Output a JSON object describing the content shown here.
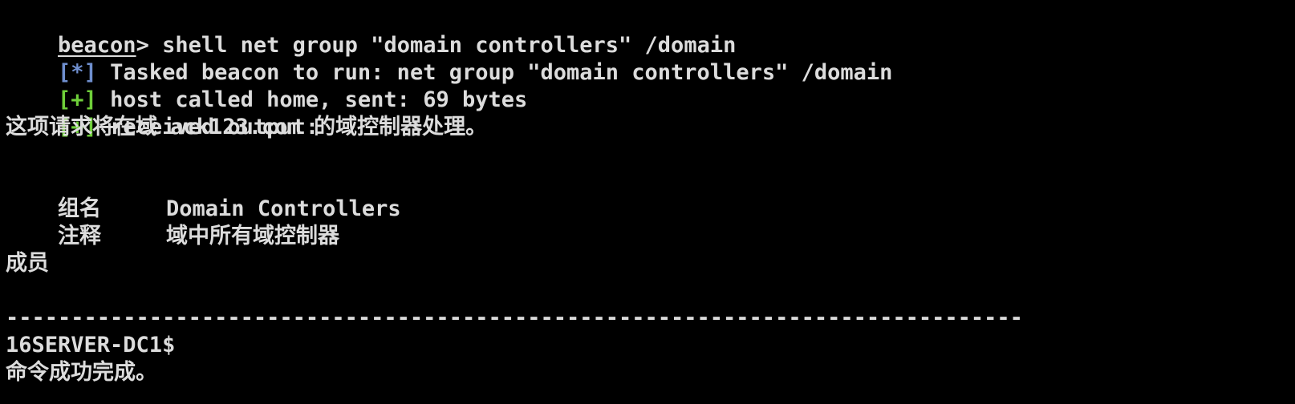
{
  "colors": {
    "background": "#000000",
    "foreground": "#dcdcdc",
    "info_tag": "#6f8fcf",
    "ok_tag": "#6fcf3a"
  },
  "prompt": {
    "name": "beacon",
    "symbol": ">",
    "command": " shell net group \"domain controllers\" /domain"
  },
  "log": [
    {
      "tag": "[*]",
      "type": "info",
      "text": " Tasked beacon to run: net group \"domain controllers\" /domain"
    },
    {
      "tag": "[+]",
      "type": "ok",
      "text": " host called home, sent: 69 bytes"
    },
    {
      "tag": "[+]",
      "type": "ok",
      "text": " received output:"
    }
  ],
  "output": {
    "intro": "这项请求将在域 ack123.com 的域控制器处理。",
    "group_name_label": "组名",
    "group_name_value": "Domain Controllers",
    "comment_label": "注释",
    "comment_value": "域中所有域控制器",
    "members_label": "成员",
    "separator": "-------------------------------------------------------------------------------",
    "member": "16SERVER-DC1$",
    "done": "命令成功完成。"
  }
}
